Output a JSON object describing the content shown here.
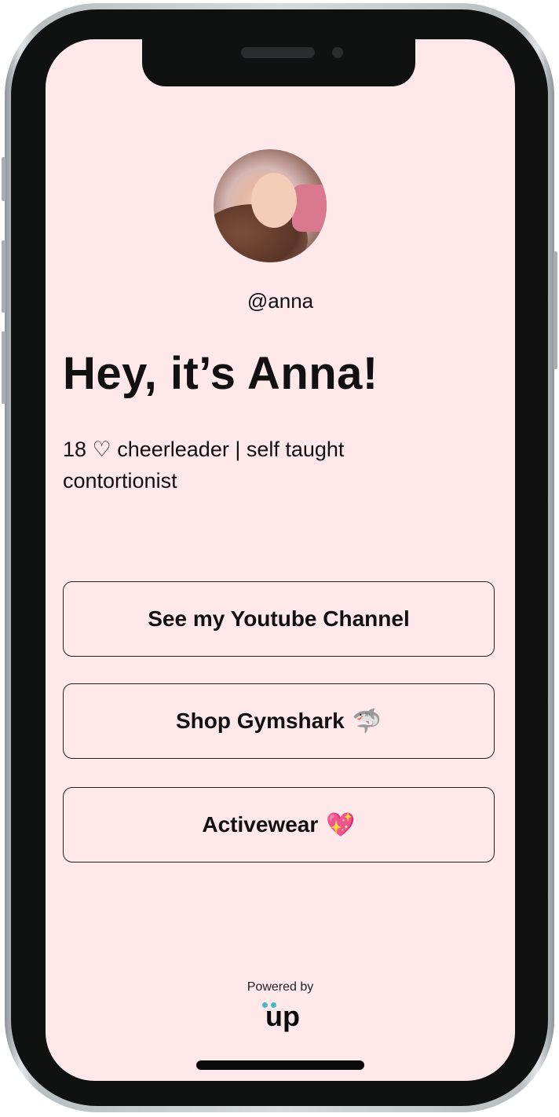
{
  "profile": {
    "handle": "@anna",
    "title": "Hey, it’s Anna!",
    "bio": "18 ♡ cheerleader | self taught contortionist"
  },
  "links": [
    {
      "label": "See my Youtube Channel",
      "emoji": ""
    },
    {
      "label": "Shop Gymshark",
      "emoji": "🦈"
    },
    {
      "label": "Activewear",
      "emoji": "💖"
    }
  ],
  "footer": {
    "powered_label": "Powered by",
    "logo_text": "up"
  },
  "colors": {
    "screen_background": "#ffe8e9",
    "logo_dots": "#48b8c4",
    "text": "#111111"
  }
}
